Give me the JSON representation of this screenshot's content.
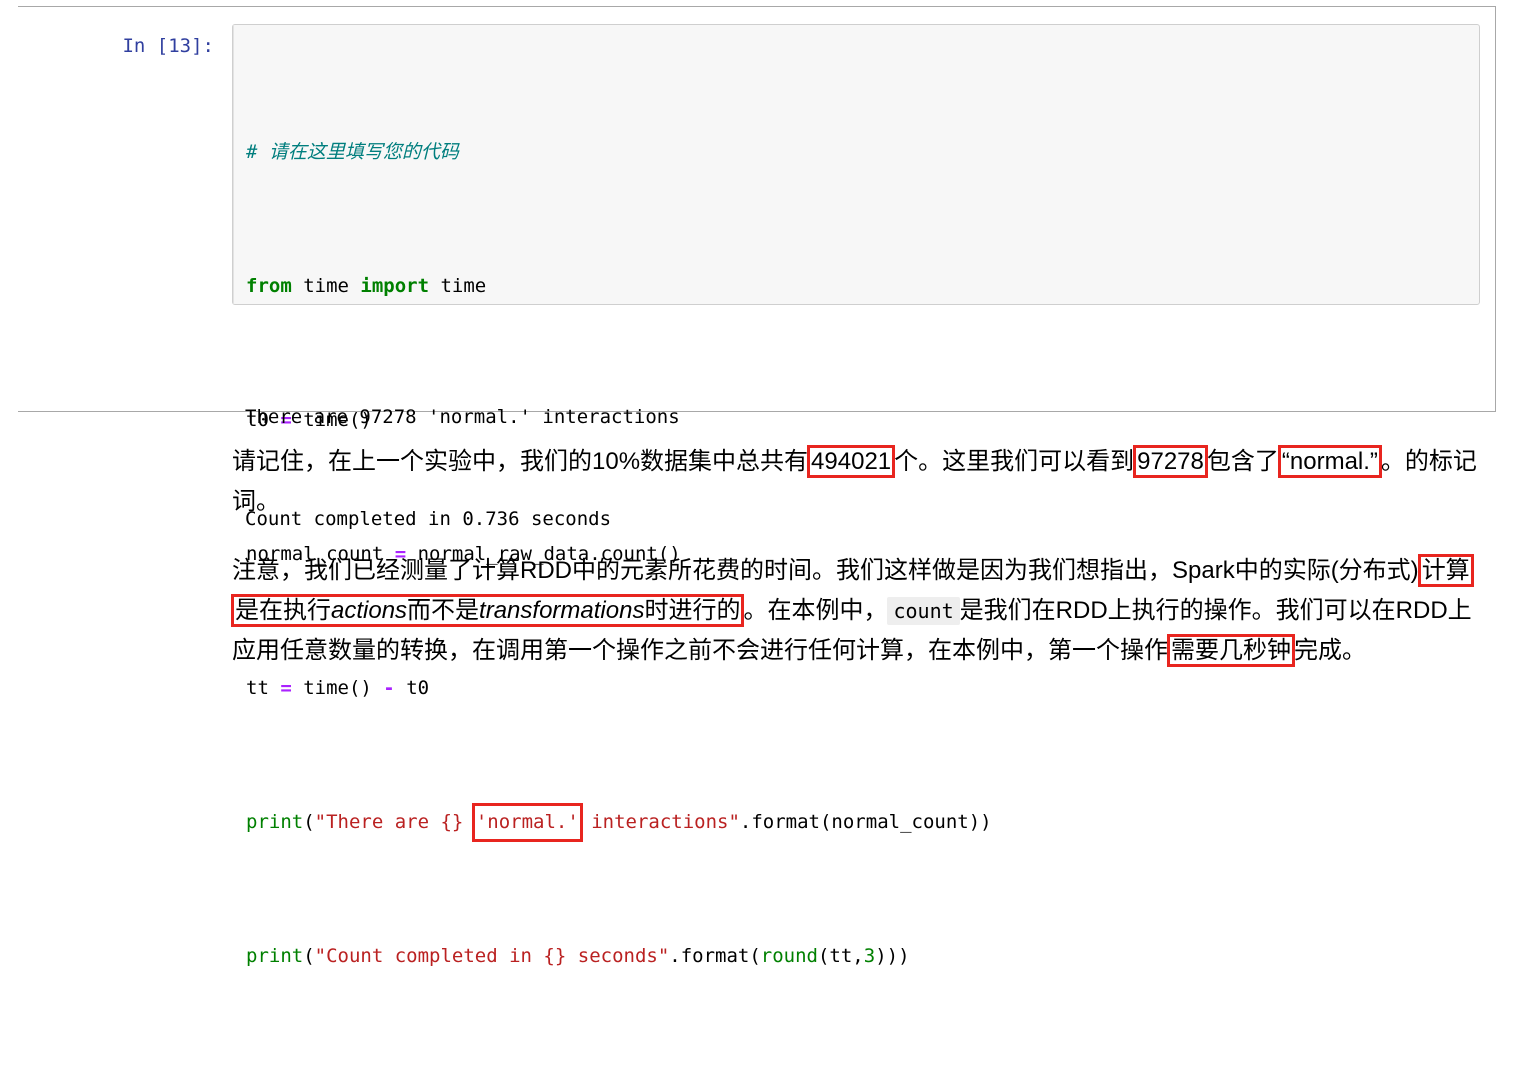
{
  "theme": {
    "selection_bar_color": "#42a5f5",
    "cell_border_color": "#a8a8a8",
    "code_background": "#f7f7f7",
    "code_border": "#cfcfcf",
    "prompt_color": "#303f9f",
    "annotation_color": "#e8251f",
    "comment_color": "#007e7e",
    "keyword_color": "#008000",
    "string_color": "#ba2121",
    "operator_color": "#aa22ff",
    "inline_code_background": "#eeeeee"
  },
  "cell": {
    "input_prompt": "In [13]:",
    "code": {
      "line1": {
        "comment": "# 请在这里填写您的代码"
      },
      "line2": {
        "kw_from": "from",
        "mod": " time ",
        "kw_import": "import",
        "name": " time"
      },
      "line3": {
        "var": "t0 ",
        "op": "=",
        "call": " time()"
      },
      "line4": {
        "var": "normal_count ",
        "op": "=",
        "call": " normal_raw_data.count()"
      },
      "line5": {
        "var": "tt ",
        "op1": "=",
        "call": " time() ",
        "op2": "-",
        "var2": " t0"
      },
      "line6": {
        "fn": "print",
        "paren_open": "(",
        "str_a": "\"There are {} ",
        "highlighted": "'normal.'",
        "str_b": " interactions\"",
        "tail": ".format(normal_count))"
      },
      "line7": {
        "fn": "print",
        "paren_open": "(",
        "str": "\"Count completed in {} seconds\"",
        "mid": ".format(",
        "fn2": "round",
        "args_open": "(tt,",
        "num": "3",
        "tail": ")))"
      }
    },
    "output": {
      "line1": "There are 97278 'normal.' interactions",
      "line2": "Count completed in 0.736 seconds"
    }
  },
  "prose": {
    "paragraph1": {
      "seg1": "请记住，在上一个实验中，我们的10%数据集中总共有",
      "hl1": "494021",
      "seg2": "个。这里我们可以看到",
      "hl2": "97278",
      "seg3": "包含了",
      "hl3": "“normal.”",
      "seg4": "。的标记词。"
    },
    "paragraph2": {
      "seg1": "注意，我们已经测量了计算RDD中的元素所花费的时间。我们这样做是因为我们想指出，Spark中的实际(分布式)",
      "hl_start": "计算是在执行",
      "hl_em1": "actions",
      "hl_mid": "而不是",
      "hl_em2": "transformations",
      "hl_end": "时进行的",
      "seg2": "。在本例中，",
      "code": "count",
      "seg3": "是我们在RDD上执行的操作。我们可以在RDD上应用任意数量的转换，在调用第一个操作之前不会进行任何计算，在本例中，第一个操作",
      "hl4": "需要几秒钟",
      "seg4": "完成。"
    }
  }
}
